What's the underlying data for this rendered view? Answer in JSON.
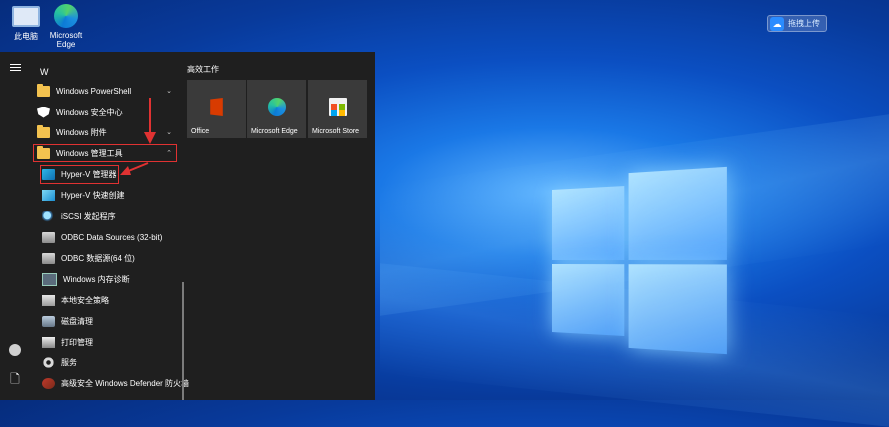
{
  "desktop": {
    "icons": [
      {
        "label": "此电脑"
      },
      {
        "label": "Microsoft Edge"
      }
    ],
    "upload_button": "拖拽上传"
  },
  "start_menu": {
    "section_letter": "W",
    "items": [
      {
        "label": "Windows PowerShell",
        "chevron": "⌄"
      },
      {
        "label": "Windows 安全中心"
      },
      {
        "label": "Windows 附件",
        "chevron": "⌄"
      },
      {
        "label": "Windows 管理工具",
        "chevron": "⌃"
      },
      {
        "label": "Hyper-V 管理器"
      },
      {
        "label": "Hyper-V 快速创建"
      },
      {
        "label": "iSCSI 发起程序"
      },
      {
        "label": "ODBC Data Sources (32-bit)"
      },
      {
        "label": "ODBC 数据源(64 位)"
      },
      {
        "label": "Windows 内存诊断"
      },
      {
        "label": "本地安全策略"
      },
      {
        "label": "磁盘清理"
      },
      {
        "label": "打印管理"
      },
      {
        "label": "服务"
      },
      {
        "label": "高级安全 Windows Defender 防火墙"
      }
    ],
    "tiles_title": "高效工作",
    "tiles": [
      {
        "label": "Office"
      },
      {
        "label": "Microsoft Edge"
      },
      {
        "label": "Microsoft Store"
      }
    ]
  },
  "colors": {
    "highlight": "#e03232",
    "menu_bg": "#1f1f1f",
    "tile_bg": "#3a3a3a"
  }
}
